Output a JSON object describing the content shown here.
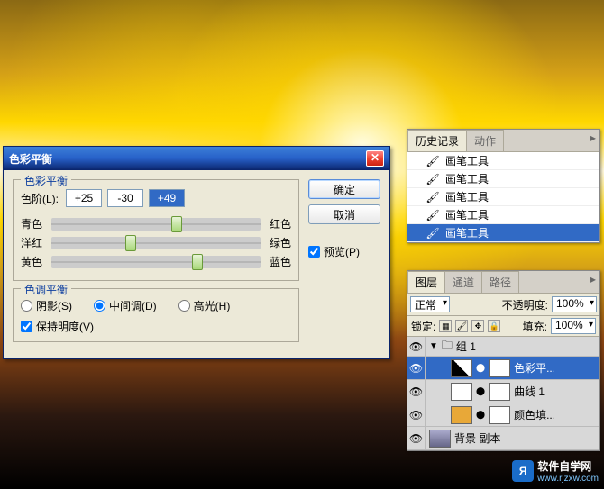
{
  "dialog": {
    "title": "色彩平衡",
    "group1": {
      "legend": "色彩平衡",
      "levels_label": "色阶(L):",
      "val1": "+25",
      "val2": "-30",
      "val3": "+49",
      "sliders": [
        {
          "left": "青色",
          "right": "红色",
          "pos": 60
        },
        {
          "left": "洋红",
          "right": "绿色",
          "pos": 38
        },
        {
          "left": "黄色",
          "right": "蓝色",
          "pos": 70
        }
      ]
    },
    "group2": {
      "legend": "色调平衡",
      "options": [
        {
          "label": "阴影(S)",
          "checked": false
        },
        {
          "label": "中间调(D)",
          "checked": true
        },
        {
          "label": "高光(H)",
          "checked": false
        }
      ],
      "preserve": "保持明度(V)"
    },
    "buttons": {
      "ok": "确定",
      "cancel": "取消"
    },
    "preview": "预览(P)"
  },
  "history": {
    "tabs": [
      "历史记录",
      "动作"
    ],
    "items": [
      "画笔工具",
      "画笔工具",
      "画笔工具",
      "画笔工具",
      "画笔工具"
    ]
  },
  "layers": {
    "tabs": [
      "图层",
      "通道",
      "路径"
    ],
    "mode": "正常",
    "opacity_label": "不透明度:",
    "opacity": "100%",
    "lock_label": "锁定:",
    "fill_label": "填充:",
    "fill": "100%",
    "group": "组 1",
    "items": [
      {
        "name": "色彩平...",
        "selected": true
      },
      {
        "name": "曲线 1",
        "selected": false
      },
      {
        "name": "颜色填...",
        "selected": false
      }
    ],
    "bg": "背景 副本"
  },
  "watermark": {
    "brand": "软件自学网",
    "url": "www.rjzxw.com"
  }
}
